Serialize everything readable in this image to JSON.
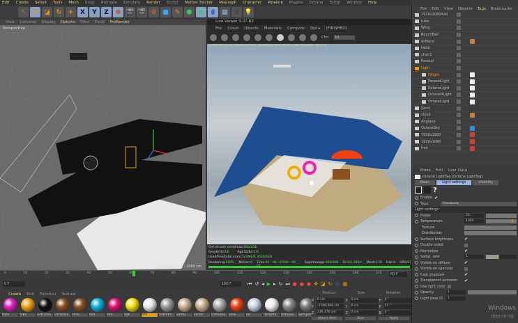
{
  "menu": [
    "Edit",
    "Create",
    "Select",
    "Tools",
    "Mesh",
    "Snap",
    "Animate",
    "Simulate",
    "Render",
    "Sculpt",
    "Motion Tracker",
    "MoGraph",
    "Character",
    "Pipeline",
    "Plugins",
    "Octane",
    "Script",
    "Window",
    "Help"
  ],
  "toolbar": {
    "x": "X",
    "y": "Y",
    "z": "Z"
  },
  "viewport": {
    "menu": [
      "View",
      "Cameras",
      "Display",
      "Options",
      "Filter",
      "Panel",
      "ProRender"
    ],
    "label": "Perspective",
    "grid": "Grid Spacing : 1000 cm"
  },
  "live_viewer": {
    "title": "Live Viewer 3.07-R2",
    "menu": [
      "File",
      "Cloud",
      "Objects",
      "Materials",
      "Compare",
      "Opt ▸",
      "[FINISHED]"
    ],
    "channel_label": "Chn:",
    "channel": "DL",
    "info": "Credit:0ms/1ms MeshGen:0ms  Update[E]:0ms  Nodes:284 Movable:140  0 0",
    "stats": [
      {
        "k": "Out-of-core used/max:",
        "v": "0Kb/4Gb"
      },
      {
        "k": "Grey8/16:",
        "v": "0/0",
        "k2": "Rgb32/64:",
        "v2": "1/0"
      },
      {
        "k": "Used/free/total vram:",
        "v": "543Mb/4.363b/6Gb"
      }
    ],
    "status": {
      "rendering": "Rendering:",
      "pct": "100%",
      "ms_label": "Ms/sec:",
      "ms": "0",
      "time_label": "Time:",
      "time": "00 : 00 : 07/00 : 00 : 07",
      "spp_label": "Spp/maxspp:",
      "spp": "300/300",
      "tri_label": "Tri:",
      "tri": "0/1.285m",
      "mesh_label": "Mesh:",
      "mesh": "138",
      "hair_label": "Hair:",
      "hair": "0",
      "gpu_label": "GPU:",
      "gpu": "67"
    },
    "progress": 1.0
  },
  "timeline": {
    "ticks": [
      "0",
      "10",
      "20",
      "30",
      "40",
      "50",
      "60",
      "70",
      "80",
      "90",
      "100",
      "110",
      "120",
      "130",
      "140",
      "150",
      "160",
      "170",
      "180"
    ],
    "current": "0 F",
    "end": "180 F",
    "end2": "60 F"
  },
  "materials": {
    "menu": [
      "Create",
      "Edit",
      "Function",
      "Texture"
    ],
    "items": [
      {
        "name": "tube",
        "color": "#e020c0"
      },
      {
        "name": "tube",
        "color": "#f0a010"
      },
      {
        "name": "OctGloss",
        "color": "#111"
      },
      {
        "name": "OctGloss",
        "color": "#8a5020"
      },
      {
        "name": "chair",
        "color": "#8a5020"
      },
      {
        "name": "ball",
        "color": "#10b0e0"
      },
      {
        "name": "ball",
        "color": "#e01070"
      },
      {
        "name": "ball",
        "color": "#f0e010"
      },
      {
        "name": "ball",
        "color": "#e8e8e8",
        "selected": true
      },
      {
        "name": "OctDiffu",
        "color": "#999"
      },
      {
        "name": "sand1",
        "color": "#c8b090"
      },
      {
        "name": "sand2",
        "color": "#c8b090"
      },
      {
        "name": "OctGloss",
        "color": "#aaa"
      },
      {
        "name": "para",
        "color": "#f04010"
      },
      {
        "name": "pa",
        "color": "#c8d4e4"
      },
      {
        "name": "OctDiffu",
        "color": "#eee"
      },
      {
        "name": "OctSpec",
        "color": "#888"
      },
      {
        "name": "OctSpec",
        "color": "#777"
      }
    ]
  },
  "coords": {
    "headers": [
      "Position",
      "Size",
      "Rotation"
    ],
    "rows": [
      [
        "X",
        "0 cm",
        "X",
        "0 cm",
        "H",
        "0 °"
      ],
      [
        "Y",
        "-1198.468 cm",
        "Y",
        "0 cm",
        "P",
        "55 °"
      ],
      [
        "Z",
        "236.476 cm",
        "Z",
        "0 cm",
        "B",
        "0 °"
      ]
    ],
    "mode": "Object (Rel)",
    "size_mode": "Size",
    "apply": "Apply"
  },
  "object_manager": {
    "menu": [
      "File",
      "Edit",
      "View",
      "Objects",
      "Tags",
      "Bookmarks"
    ],
    "items": [
      {
        "name": "1920x1080Add",
        "tag": ""
      },
      {
        "name": "tube",
        "tag": ""
      },
      {
        "name": "Wing",
        "tag": ""
      },
      {
        "name": "BeachBall",
        "tag": ""
      },
      {
        "name": "ArPlane",
        "tag": "#c08040"
      },
      {
        "name": "table",
        "tag": ""
      },
      {
        "name": "chair1",
        "tag": ""
      },
      {
        "name": "Parasol",
        "tag": ""
      },
      {
        "name": "Light",
        "tag": "",
        "highlight": true
      },
      {
        "name": "Fillight",
        "tag": "#eee",
        "highlight": true
      },
      {
        "name": "ParasolLight",
        "tag": "#eee"
      },
      {
        "name": "OctaneLight",
        "tag": "#eee"
      },
      {
        "name": "OctaneRLight",
        "tag": "#eee"
      },
      {
        "name": "OctaneLight",
        "tag": "#eee"
      },
      {
        "name": "Sand",
        "tag": ""
      },
      {
        "name": "cloud",
        "tag": "#c08040"
      },
      {
        "name": "Airplane",
        "tag": ""
      },
      {
        "name": "OctaneSky",
        "tag": "#3090e0"
      },
      {
        "name": "1920x1920",
        "tag": "#d04030"
      },
      {
        "name": "1920x1080",
        "tag": "#d04030"
      },
      {
        "name": "free",
        "tag": "#d04030"
      }
    ]
  },
  "attributes": {
    "menu": [
      "Mode",
      "Edit",
      "User Data"
    ],
    "title": "Octane LightTag [Octane LightTag]",
    "tabs": [
      "Basic",
      "Light settings",
      "Visibility"
    ],
    "help": "?",
    "enable": "Enable",
    "type_label": "Type",
    "type": "Blackbody",
    "section": "Light settings",
    "power": "Power",
    "power_val": "20.",
    "temperature": "Temperature",
    "temp_val": "1000",
    "texture": "Texture",
    "distribution": "Distribution",
    "checks": [
      {
        "l": "Surface brightness",
        "v": true
      },
      {
        "l": "Double sided",
        "v": false
      },
      {
        "l": "Normalize",
        "v": true
      }
    ],
    "samp": "Samp. rate",
    "samp_val": "1.",
    "vis": [
      {
        "l": "Visible on diffuse",
        "v": true
      },
      {
        "l": "Visible on specular",
        "v": false
      },
      {
        "l": "Cast shadows",
        "v": true
      },
      {
        "l": "Transparent emission",
        "v": true
      }
    ],
    "use_light_color": "Use light color",
    "opacity": "Opacity",
    "opacity_val": "1.",
    "pass": "Light pass ID",
    "pass_val": "1"
  },
  "watermark": "Windows",
  "watermark2": "[설정]으로 이동"
}
